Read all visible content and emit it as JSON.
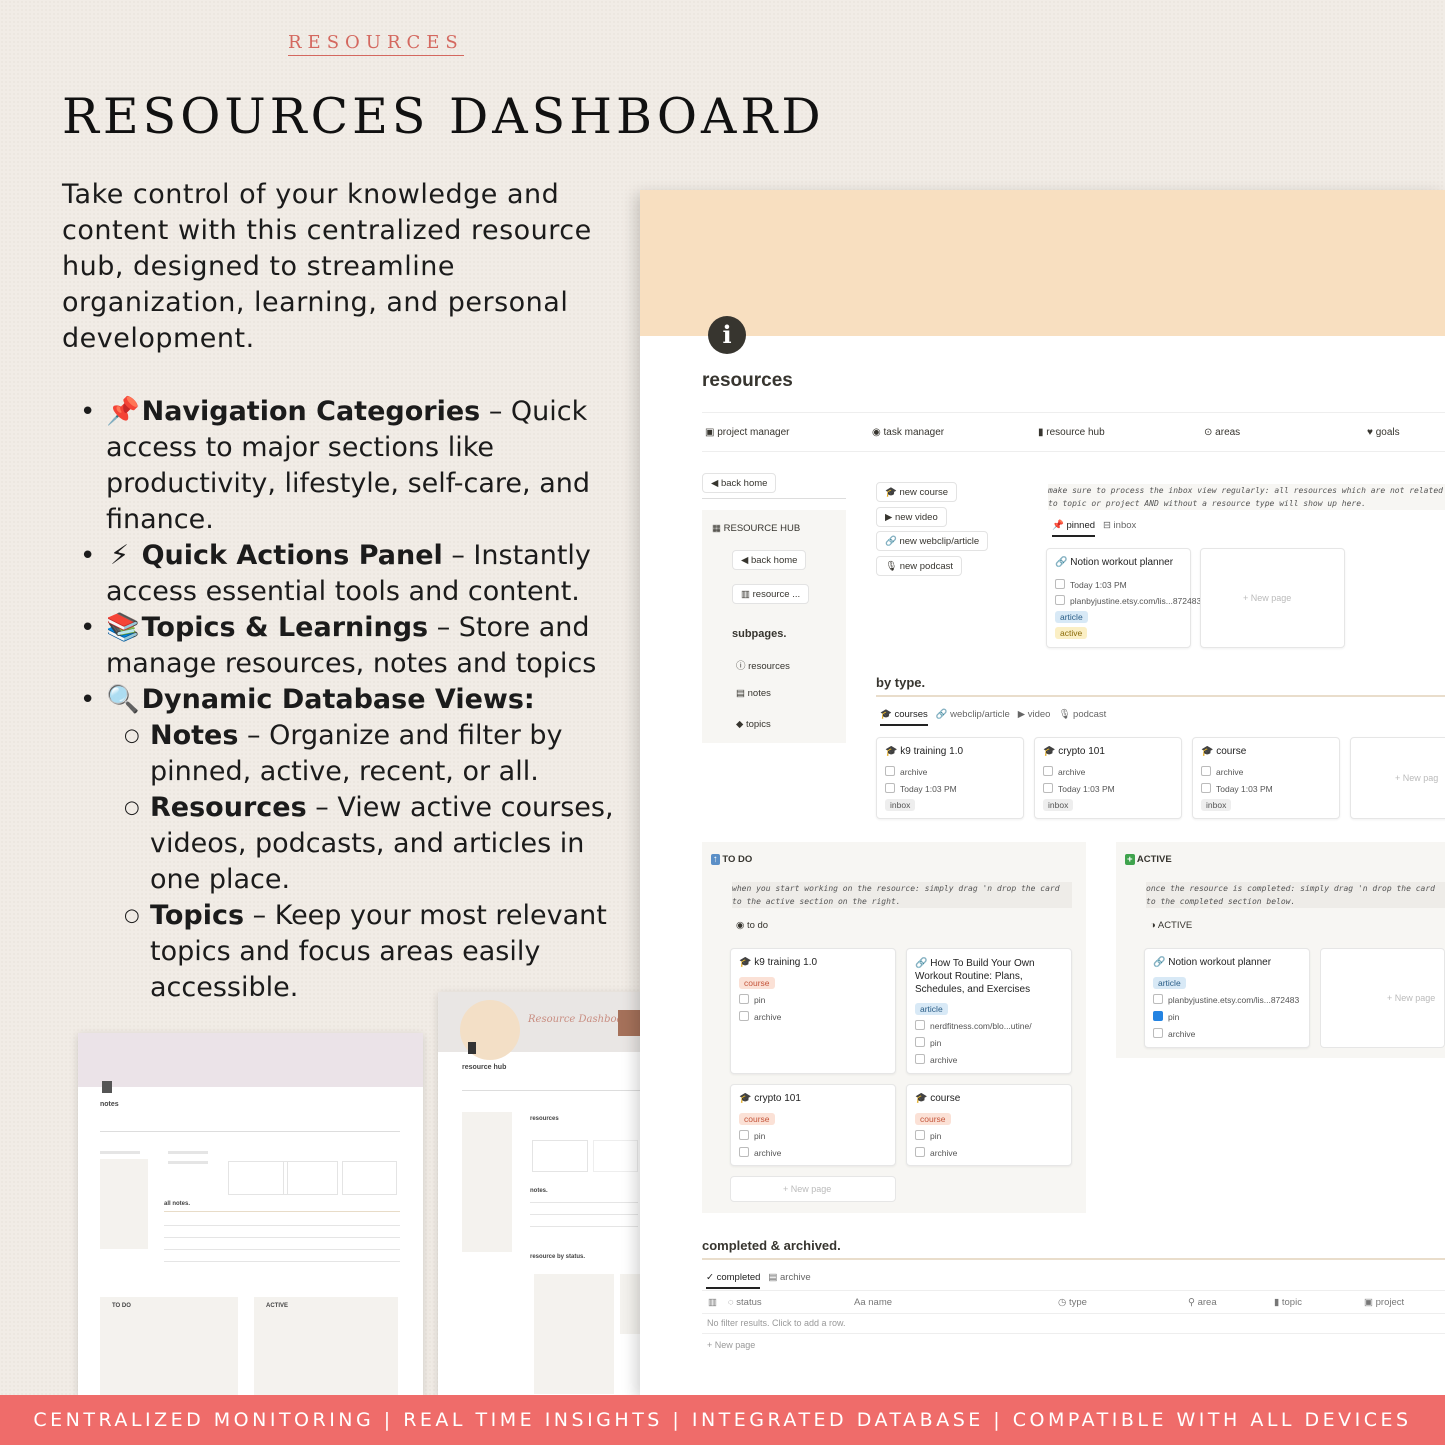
{
  "kicker": "RESOURCES",
  "title": "RESOURCES DASHBOARD",
  "intro": "Take control of your knowledge and content with this centralized resource hub, designed to streamline organization, learning, and personal development.",
  "bullets": [
    {
      "emoji": "📌",
      "title": "Navigation Categories",
      "text": " – Quick access to major sections like productivity, lifestyle, self-care, and finance."
    },
    {
      "emoji": "⚡",
      "title": "Quick Actions Panel",
      "text": " – Instantly access essential tools and content."
    },
    {
      "emoji": "📚",
      "title": "Topics & Learnings",
      "text": " – Store and manage resources, notes and topics"
    },
    {
      "emoji": "🔍",
      "title": "Dynamic Database Views:",
      "text": ""
    }
  ],
  "subbullets": [
    {
      "title": "Notes",
      "text": " – Organize and filter by pinned, active, recent, or all."
    },
    {
      "title": "Resources",
      "text": " – View active courses, videos, podcasts, and articles in one place."
    },
    {
      "title": "Topics",
      "text": " – Keep your most relevant topics and focus areas easily accessible."
    }
  ],
  "panel": {
    "title": "resources",
    "nav": [
      "project manager",
      "task manager",
      "resource hub",
      "areas",
      "goals"
    ],
    "back_home": "back home",
    "hub_title": "RESOURCE HUB",
    "hub_back": "back home",
    "hub_resource": "resource ...",
    "subpages_title": "subpages.",
    "subpages": [
      "resources",
      "notes",
      "topics"
    ],
    "actions": [
      "new course",
      "new video",
      "new webclip/article",
      "new podcast"
    ],
    "inbox_note": "make sure to process the inbox view regularly: all resources which are not related to topic or project AND without a resource type will show up here.",
    "inbox_tabs": [
      "pinned",
      "inbox"
    ],
    "pinned_card": {
      "title": "Notion workout planner",
      "time": "Today 1:03 PM",
      "url": "planbyjustine.etsy.com/lis...872483",
      "type": "article",
      "status": "active"
    },
    "new_page": "+ New page",
    "bytype_title": "by type.",
    "bytype_tabs": [
      "courses",
      "webclip/article",
      "video",
      "podcast"
    ],
    "type_cards": [
      {
        "title": "k9 training 1.0",
        "check": "archive",
        "time": "Today 1:03 PM",
        "tag": "inbox"
      },
      {
        "title": "crypto 101",
        "check": "archive",
        "time": "Today 1:03 PM",
        "tag": "inbox"
      },
      {
        "title": "course",
        "check": "archive",
        "time": "Today 1:03 PM",
        "tag": "inbox"
      }
    ],
    "new_page_cut": "+ New pag",
    "todo": {
      "title": "TO DO",
      "note": "when you start working on the resource: simply drag 'n drop the card to the active section on the right.",
      "view": "to do",
      "cards": [
        {
          "title": "k9 training 1.0",
          "tag": "course"
        },
        {
          "title": "How To Build Your Own Workout Routine: Plans, Schedules, and Exercises",
          "tag": "article",
          "url": "nerdfitness.com/blo...utine/"
        },
        {
          "title": "crypto 101",
          "tag": "course"
        },
        {
          "title": "course",
          "tag": "course"
        }
      ],
      "pin": "pin",
      "archive": "archive",
      "new_page": "+ New page"
    },
    "active": {
      "title": "ACTIVE",
      "note": "once the resource is completed: simply drag 'n drop the card to the completed section below.",
      "view": "ACTIVE",
      "card": {
        "title": "Notion workout planner",
        "tag": "article",
        "url": "planbyjustine.etsy.com/lis...872483"
      },
      "new_page": "+ New page"
    },
    "completed": {
      "title": "completed & archived.",
      "tabs": [
        "completed",
        "archive"
      ],
      "columns": [
        "status",
        "Aa name",
        "type",
        "area",
        "topic",
        "project"
      ],
      "empty": "No filter results. Click to add a row.",
      "new_page": "+ New page"
    }
  },
  "thumb_notes": {
    "title": "notes",
    "section": "all notes.",
    "todo": "TO DO",
    "active": "ACTIVE"
  },
  "thumb_hub": {
    "title": "resource hub",
    "script": "Resource Dashboard",
    "section": "resources",
    "notes": "notes.",
    "status": "resource by status."
  },
  "footer": "CENTRALIZED MONITORING   |   REAL TIME INSIGHTS   |   INTEGRATED DATABASE   |   COMPATIBLE WITH ALL DEVICES"
}
